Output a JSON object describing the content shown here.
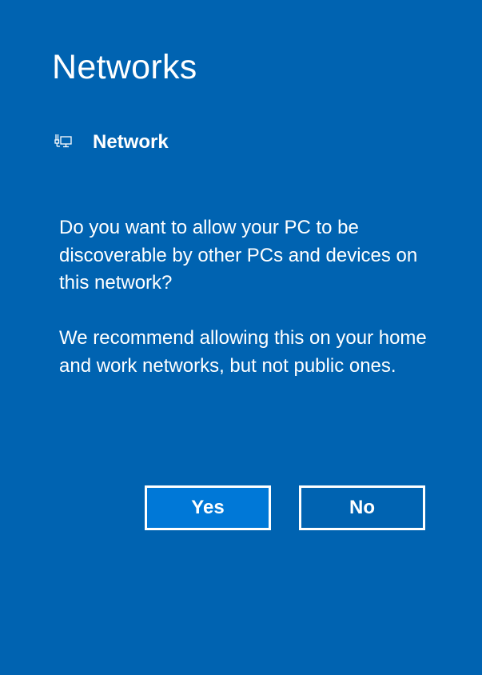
{
  "panel": {
    "title": "Networks",
    "background_color": "#0063b1"
  },
  "network": {
    "icon": "wired-network-icon",
    "name": "Network"
  },
  "dialog": {
    "question": "Do you want to allow your PC to be discoverable by other PCs and devices on this network?",
    "recommendation": "We recommend allowing this on your home and work networks, but not public ones."
  },
  "buttons": {
    "yes_label": "Yes",
    "no_label": "No",
    "yes_color": "#0078d7"
  }
}
